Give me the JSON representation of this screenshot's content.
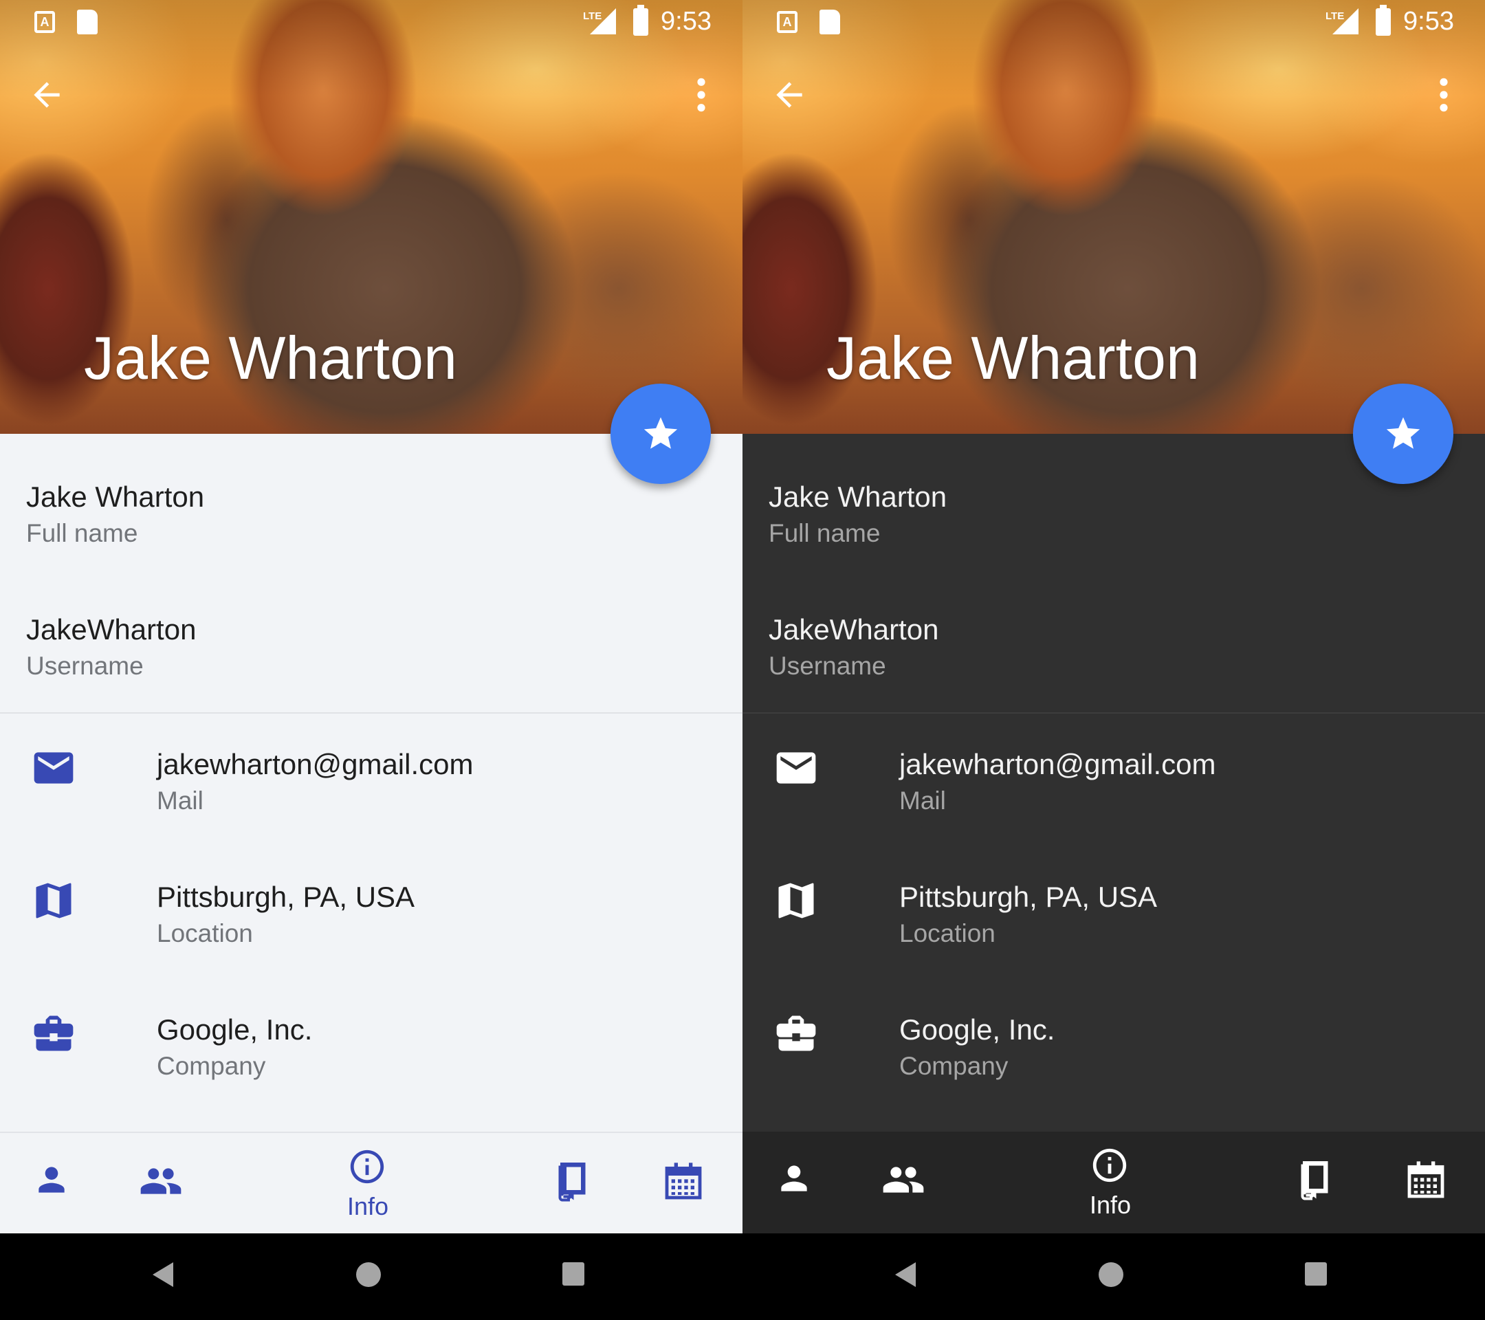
{
  "status_bar": {
    "time": "9:53",
    "network": "LTE"
  },
  "profile": {
    "header_name": "Jake Wharton"
  },
  "fields": [
    {
      "value": "Jake Wharton",
      "label": "Full name"
    },
    {
      "value": "JakeWharton",
      "label": "Username"
    },
    {
      "value": "jakewharton@gmail.com",
      "label": "Mail",
      "icon": "mail-icon"
    },
    {
      "value": "Pittsburgh, PA, USA",
      "label": "Location",
      "icon": "map-icon"
    },
    {
      "value": "Google, Inc.",
      "label": "Company",
      "icon": "briefcase-icon"
    }
  ],
  "bottom_nav": {
    "items": [
      {
        "icon": "person-icon"
      },
      {
        "icon": "people-icon"
      },
      {
        "icon": "info-icon",
        "label": "Info",
        "selected": true
      },
      {
        "icon": "book-icon"
      },
      {
        "icon": "calendar-icon"
      }
    ]
  },
  "themes": {
    "light": {
      "background": "#f2f4f7",
      "accent": "#3849b4"
    },
    "dark": {
      "background": "#303030",
      "accent": "#ffffff"
    },
    "fab_color": "#3f7ef3"
  }
}
